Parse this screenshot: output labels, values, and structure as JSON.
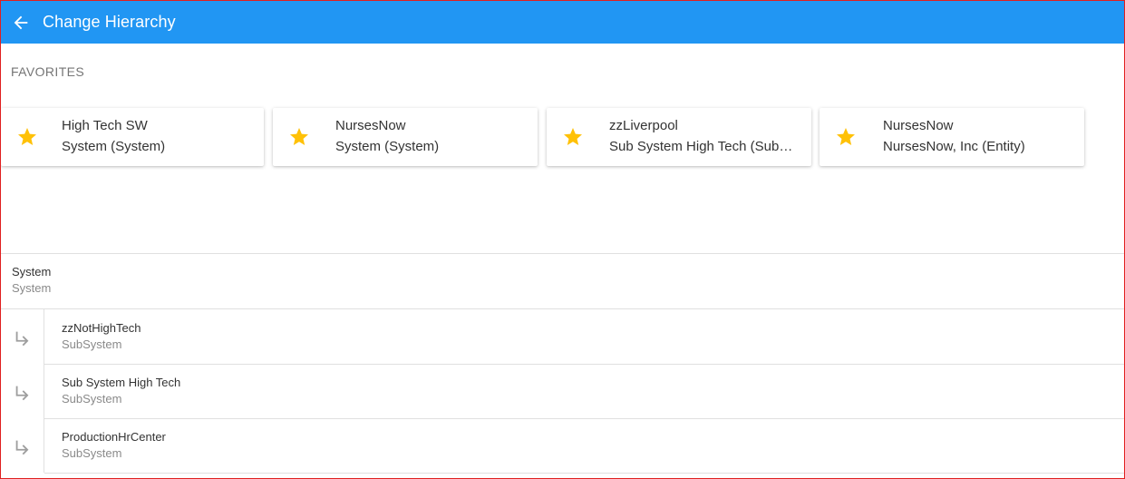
{
  "appbar": {
    "title": "Change Hierarchy",
    "back_icon": "arrow-back-icon",
    "color": "#2196f3"
  },
  "favorites": {
    "heading": "FAVORITES",
    "star_color": "#ffc107",
    "items": [
      {
        "name": "High Tech SW",
        "subtitle": "System (System)"
      },
      {
        "name": "NursesNow",
        "subtitle": "System (System)"
      },
      {
        "name": "zzLiverpool",
        "subtitle": "Sub System High Tech (SubSystem)"
      },
      {
        "name": "NursesNow",
        "subtitle": "NursesNow, Inc (Entity)"
      }
    ]
  },
  "hierarchy": {
    "root": {
      "name": "System",
      "type": "System"
    },
    "children": [
      {
        "name": "zzNotHighTech",
        "type": "SubSystem"
      },
      {
        "name": "Sub System High Tech",
        "type": "SubSystem"
      },
      {
        "name": "ProductionHrCenter",
        "type": "SubSystem"
      }
    ]
  }
}
